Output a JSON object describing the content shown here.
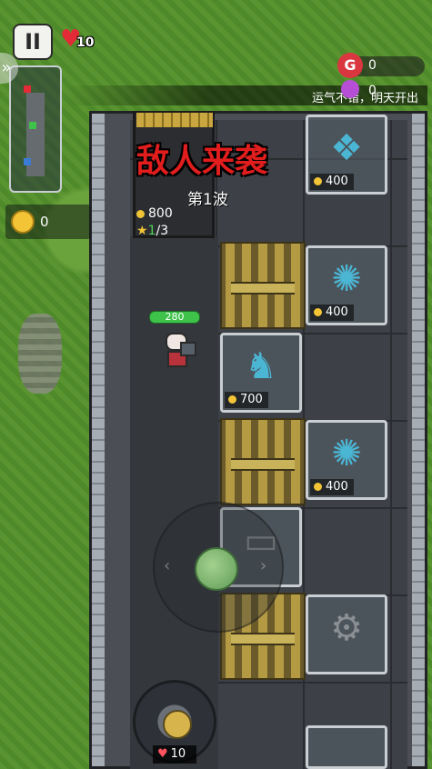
{
  "hud": {
    "pause_label": "II",
    "lives": "10",
    "gold": "0",
    "g_icon_label": "G",
    "g_count": "0",
    "gem_count": "0",
    "notice": "运气不错，明天开出"
  },
  "wave": {
    "title": "敌人来袭",
    "label": "第1波",
    "reward": "800",
    "stars_current": "1",
    "stars_total": "/3"
  },
  "hero": {
    "hp": "280"
  },
  "slots": [
    {
      "name": "slot-crystal-top",
      "price": "400",
      "icon": "crystal-icon"
    },
    {
      "name": "slot-crystal-2",
      "price": "400",
      "icon": "crystal-icon"
    },
    {
      "name": "slot-knight",
      "price": "700",
      "icon": "knight-icon"
    },
    {
      "name": "slot-crystal-3",
      "price": "400",
      "icon": "crystal-icon"
    }
  ],
  "skill": {
    "cost": "10"
  },
  "colors": {
    "accent_red": "#e11d1d",
    "coin": "#f2c436",
    "hp_green": "#3ec24a"
  }
}
